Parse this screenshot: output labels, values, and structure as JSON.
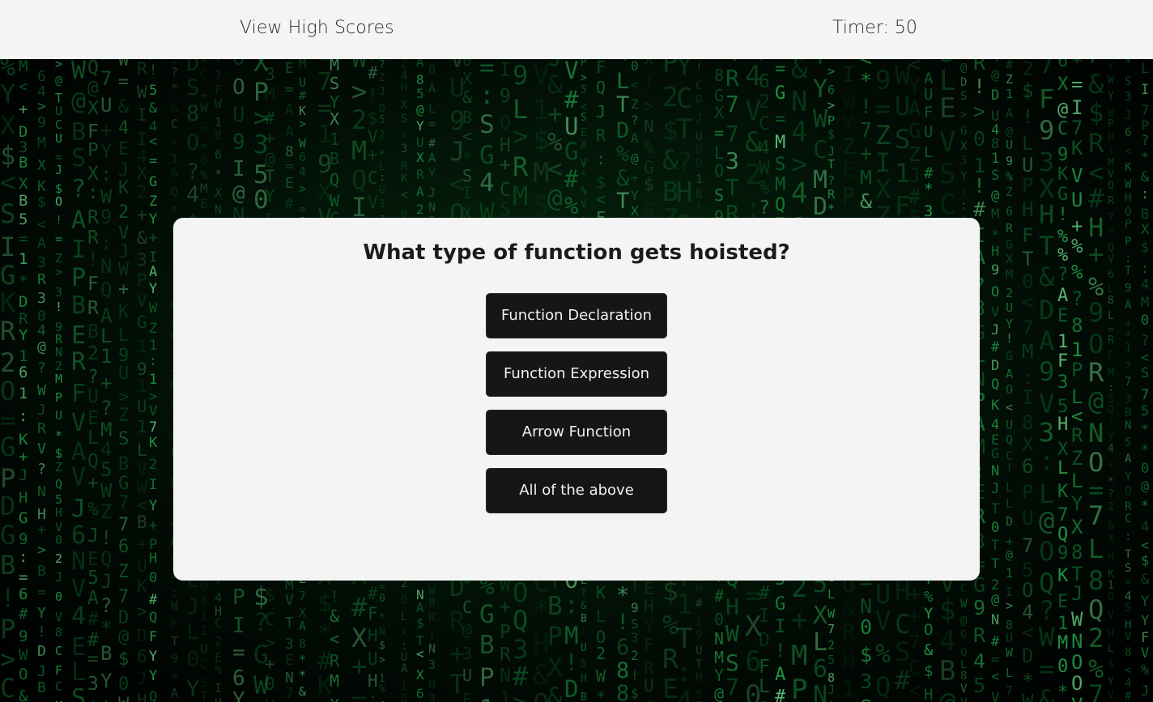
{
  "header": {
    "high_scores_label": "View High Scores",
    "timer_label": "Timer:",
    "timer_value": "50"
  },
  "quiz": {
    "question": "What type of function gets hoisted?",
    "answers": [
      "Function Declaration",
      "Function Expression",
      "Arrow Function",
      "All of the above"
    ]
  },
  "theme": {
    "background": "matrix-code-rain",
    "accent_green": "#22c55e",
    "panel_color": "#f4f4f4",
    "button_color": "#161616"
  }
}
